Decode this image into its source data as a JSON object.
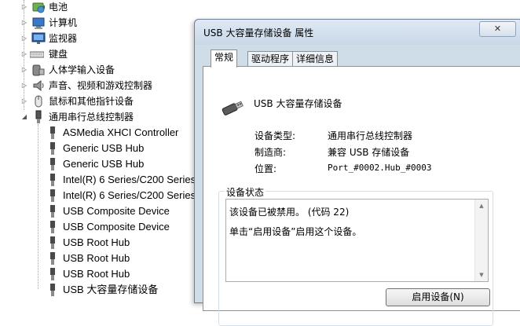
{
  "tree": {
    "items": [
      {
        "label": "电池",
        "expander": "▷",
        "icon": "battery-icon"
      },
      {
        "label": "计算机",
        "expander": "▷",
        "icon": "computer-icon"
      },
      {
        "label": "监视器",
        "expander": "▷",
        "icon": "monitor-icon"
      },
      {
        "label": "键盘",
        "expander": "▷",
        "icon": "keyboard-icon"
      },
      {
        "label": "人体学输入设备",
        "expander": "▷",
        "icon": "hid-icon"
      },
      {
        "label": "声音、视频和游戏控制器",
        "expander": "▷",
        "icon": "speaker-icon"
      },
      {
        "label": "鼠标和其他指针设备",
        "expander": "▷",
        "icon": "mouse-icon"
      },
      {
        "label": "通用串行总线控制器",
        "expander": "◢",
        "icon": "usb-controller-icon"
      }
    ],
    "children": [
      {
        "label": "ASMedia XHCI Controller"
      },
      {
        "label": "Generic USB Hub"
      },
      {
        "label": "Generic USB Hub"
      },
      {
        "label": "Intel(R) 6 Series/C200 Series"
      },
      {
        "label": "Intel(R) 6 Series/C200 Series"
      },
      {
        "label": "USB Composite Device"
      },
      {
        "label": "USB Composite Device"
      },
      {
        "label": "USB Root Hub"
      },
      {
        "label": "USB Root Hub"
      },
      {
        "label": "USB Root Hub"
      },
      {
        "label": "USB 大容量存储设备"
      }
    ]
  },
  "dialog": {
    "title": "USB 大容量存储设备 属性",
    "close_label": "✕",
    "tabs": [
      {
        "label": "常规",
        "active": true
      },
      {
        "label": "驱动程序",
        "active": false
      },
      {
        "label": "详细信息",
        "active": false
      }
    ],
    "device_name": "USB 大容量存储设备",
    "properties": {
      "type_label": "设备类型:",
      "type_value": "通用串行总线控制器",
      "manufacturer_label": "制造商:",
      "manufacturer_value": "兼容 USB 存储设备",
      "location_label": "位置:",
      "location_value": "Port_#0002.Hub_#0003"
    },
    "status_group_label": "设备状态",
    "status_text": "该设备已被禁用。 (代码 22)\n单击“启用设备”启用这个设备。",
    "enable_button": "启用设备(N)"
  }
}
